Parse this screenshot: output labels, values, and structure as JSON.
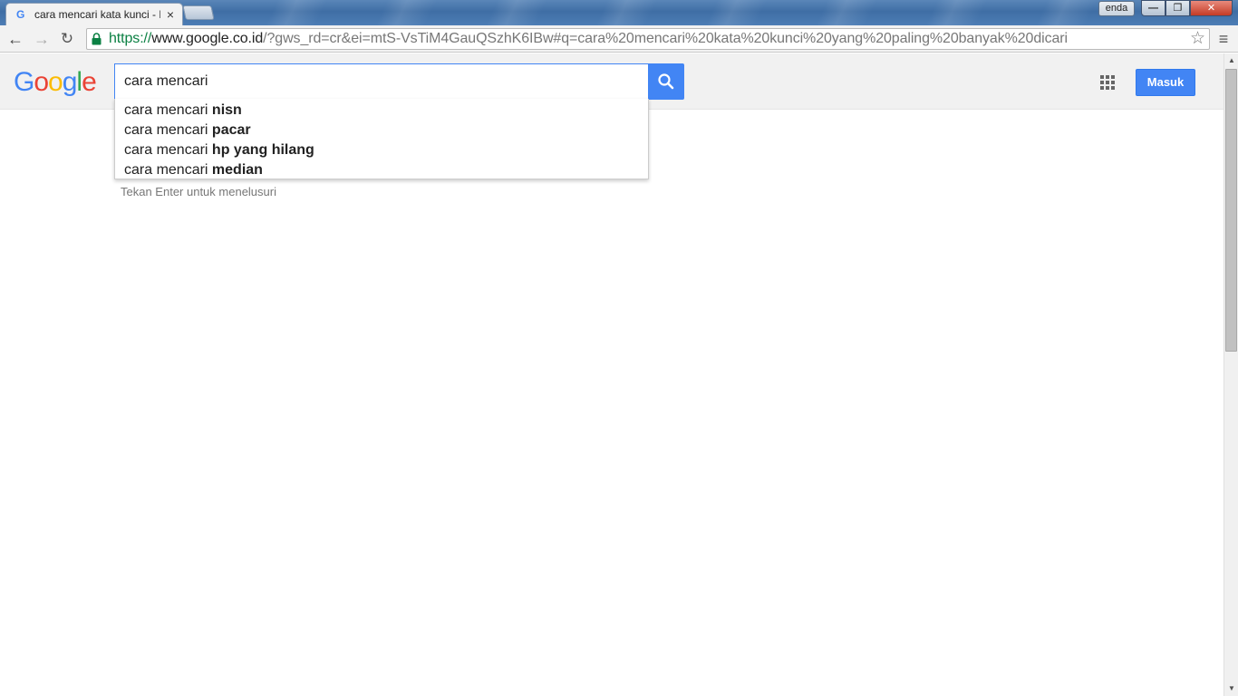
{
  "browser": {
    "tab": {
      "title": "cara mencari kata kunci - Penelusuran Google",
      "favicon": "G"
    },
    "profile_label": "enda",
    "window_buttons": {
      "minimize": "—",
      "maximize": "❐",
      "close": "✕"
    },
    "url": {
      "scheme": "https://",
      "host": "www.google.co.id",
      "rest": "/?gws_rd=cr&ei=mtS-VsTiM4GauQSzhK6IBw#q=cara%20mencari%20kata%20kunci%20yang%20paling%20banyak%20dicari"
    }
  },
  "google": {
    "logo_letters": [
      {
        "ch": "G",
        "color": "#4285f4"
      },
      {
        "ch": "o",
        "color": "#ea4335"
      },
      {
        "ch": "o",
        "color": "#fbbc05"
      },
      {
        "ch": "g",
        "color": "#4285f4"
      },
      {
        "ch": "l",
        "color": "#34a853"
      },
      {
        "ch": "e",
        "color": "#ea4335"
      }
    ],
    "search_query": "cara mencari",
    "signin_label": "Masuk",
    "suggestions": [
      {
        "prefix": "cara mencari ",
        "completion": "nisn"
      },
      {
        "prefix": "cara mencari ",
        "completion": "pacar"
      },
      {
        "prefix": "cara mencari ",
        "completion": "hp yang hilang"
      },
      {
        "prefix": "cara mencari ",
        "completion": "median"
      }
    ],
    "hint": "Tekan Enter untuk menelusuri"
  },
  "colors": {
    "accent": "#4285f4",
    "header_bg": "#f1f1f1"
  }
}
